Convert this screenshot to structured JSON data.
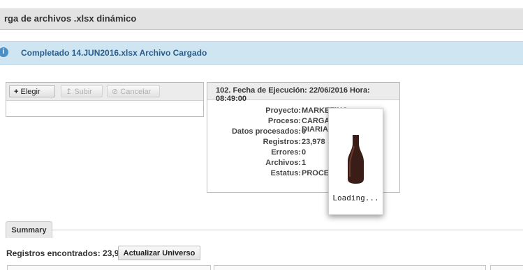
{
  "window": {
    "title": "rga de archivos .xlsx dinámico"
  },
  "message": {
    "text": "Completado 14.JUN2016.xlsx Archivo Cargado",
    "icon": "info-icon"
  },
  "upload": {
    "choose": "Elegir",
    "upload": "Subir",
    "cancel": "Cancelar"
  },
  "execution": {
    "title": "102. Fecha de Ejecución: 22/06/2016 Hora: 08:49:00",
    "fields": [
      {
        "label": "Proyecto:",
        "value": "MARKETING"
      },
      {
        "label": "Proceso:",
        "value": "CARGA HISTORICA DIARIA"
      },
      {
        "label": "Datos procesados:",
        "value": "0"
      },
      {
        "label": "Registros:",
        "value": "23,978"
      },
      {
        "label": "Errores:",
        "value": "0"
      },
      {
        "label": "Archivos:",
        "value": "1"
      },
      {
        "label": "Estatus:",
        "value": "PROCESANDO"
      }
    ]
  },
  "loading": {
    "label": "Loading..."
  },
  "tabs": {
    "summary": "Summary"
  },
  "footer": {
    "records_label": "Registros encontrados: 23,978",
    "refresh_button": "Actualizar Universo"
  }
}
